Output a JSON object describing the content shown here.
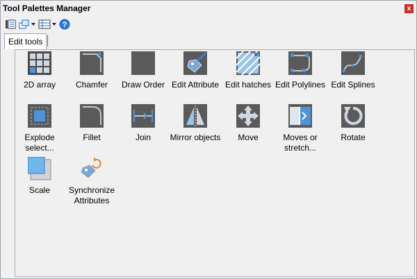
{
  "window": {
    "title": "Tool Palettes Manager",
    "close_glyph": "x"
  },
  "toolbar": {
    "buttons": [
      {
        "name": "palette-properties-icon"
      },
      {
        "name": "view-options-icon"
      },
      {
        "name": "list-view-icon"
      },
      {
        "name": "help-icon",
        "glyph": "?"
      }
    ]
  },
  "tabs": [
    {
      "label": "Edit tools"
    }
  ],
  "tools": [
    {
      "label": "2D array",
      "icon": "array-icon"
    },
    {
      "label": "Chamfer",
      "icon": "chamfer-icon"
    },
    {
      "label": "Draw Order",
      "icon": "draw-order-icon"
    },
    {
      "label": "Edit Attribute",
      "icon": "edit-attribute-icon"
    },
    {
      "label": "Edit hatches",
      "icon": "edit-hatches-icon"
    },
    {
      "label": "Edit Polylines",
      "icon": "edit-polylines-icon"
    },
    {
      "label": "Edit Splines",
      "icon": "edit-splines-icon"
    },
    {
      "label": "Explode select...",
      "icon": "explode-icon"
    },
    {
      "label": "Fillet",
      "icon": "fillet-icon"
    },
    {
      "label": "Join",
      "icon": "join-icon"
    },
    {
      "label": "Mirror objects",
      "icon": "mirror-icon"
    },
    {
      "label": "Move",
      "icon": "move-icon"
    },
    {
      "label": "Moves or stretch...",
      "icon": "stretch-icon"
    },
    {
      "label": "Rotate",
      "icon": "rotate-icon"
    },
    {
      "label": "Scale",
      "icon": "scale-icon"
    },
    {
      "label": "Synchronize Attributes",
      "icon": "synchronize-attributes-icon"
    }
  ]
}
